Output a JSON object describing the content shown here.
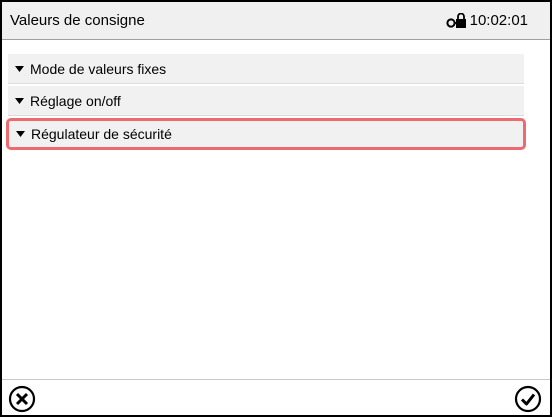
{
  "header": {
    "title": "Valeurs de consigne",
    "time": "10:02:01",
    "status_icon": "key-lock-icon"
  },
  "menu": {
    "items": [
      {
        "label": "Mode de valeurs fixes",
        "icon": "triangle-down-icon",
        "selected": false
      },
      {
        "label": "Réglage on/off",
        "icon": "triangle-down-icon",
        "selected": false
      },
      {
        "label": "Régulateur de sécurité",
        "icon": "triangle-down-icon",
        "selected": true
      }
    ]
  },
  "footer": {
    "cancel_icon": "cancel-circle-x-icon",
    "confirm_icon": "confirm-circle-check-icon"
  },
  "colors": {
    "selection_border": "#ec6a70",
    "header_bg": "#f0f0f0",
    "row_bg": "#f1f1f1"
  }
}
